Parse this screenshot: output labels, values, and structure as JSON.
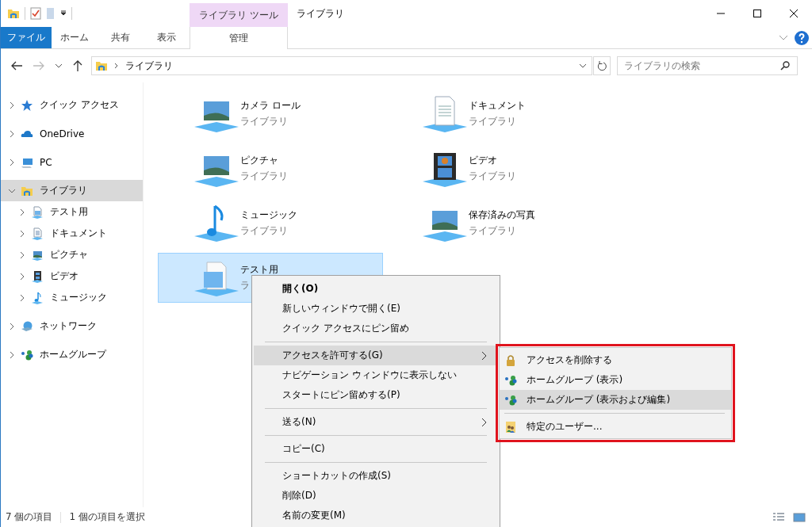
{
  "window": {
    "title": "ライブラリ",
    "contextual_group": "ライブラリ ツール"
  },
  "ribbon_tabs": [
    {
      "label": "ファイル",
      "kind": "file"
    },
    {
      "label": "ホーム",
      "kind": "normal"
    },
    {
      "label": "共有",
      "kind": "normal"
    },
    {
      "label": "表示",
      "kind": "normal"
    },
    {
      "label": "管理",
      "kind": "contextual"
    }
  ],
  "address": {
    "path": "ライブラリ"
  },
  "search": {
    "placeholder": "ライブラリの検索"
  },
  "sidebar": {
    "items": [
      {
        "label": "クイック アクセス",
        "kind": "star",
        "expanded": false,
        "selected": false
      },
      {
        "label": "OneDrive",
        "kind": "cloud",
        "expanded": false,
        "selected": false
      },
      {
        "label": "PC",
        "kind": "pc",
        "expanded": false,
        "selected": false
      },
      {
        "label": "ライブラリ",
        "kind": "library",
        "expanded": true,
        "selected": true,
        "children": [
          {
            "label": "テスト用",
            "kind": "doc",
            "expanded": false,
            "selected": false
          },
          {
            "label": "ドキュメント",
            "kind": "document",
            "expanded": false,
            "selected": false
          },
          {
            "label": "ピクチャ",
            "kind": "picture",
            "expanded": false,
            "selected": false
          },
          {
            "label": "ビデオ",
            "kind": "video",
            "expanded": false,
            "selected": false
          },
          {
            "label": "ミュージック",
            "kind": "music",
            "expanded": false,
            "selected": false
          }
        ]
      },
      {
        "label": "ネットワーク",
        "kind": "network",
        "expanded": false,
        "selected": false
      },
      {
        "label": "ホームグループ",
        "kind": "homegroup",
        "expanded": false,
        "selected": false
      }
    ]
  },
  "libraries": [
    {
      "name": "カメラ ロール",
      "subtitle": "ライブラリ",
      "kind": "picture",
      "selected": false
    },
    {
      "name": "ドキュメント",
      "subtitle": "ライブラリ",
      "kind": "document",
      "selected": false
    },
    {
      "name": "ピクチャ",
      "subtitle": "ライブラリ",
      "kind": "picture",
      "selected": false
    },
    {
      "name": "ビデオ",
      "subtitle": "ライブラリ",
      "kind": "video",
      "selected": false
    },
    {
      "name": "ミュージック",
      "subtitle": "ライブラリ",
      "kind": "music",
      "selected": false
    },
    {
      "name": "保存済みの写真",
      "subtitle": "ライブラリ",
      "kind": "picture",
      "selected": false
    },
    {
      "name": "テスト用",
      "subtitle": "ラ",
      "kind": "doc",
      "selected": true
    }
  ],
  "context_menu": {
    "items": [
      {
        "kind": "item",
        "label": "開く(O)",
        "default": true,
        "submenu": false,
        "selected": false
      },
      {
        "kind": "item",
        "label": "新しいウィンドウで開く(E)",
        "default": false,
        "submenu": false,
        "selected": false
      },
      {
        "kind": "item",
        "label": "クイック アクセスにピン留め",
        "default": false,
        "submenu": false,
        "selected": false
      },
      {
        "kind": "separator"
      },
      {
        "kind": "item",
        "label": "アクセスを許可する(G)",
        "default": false,
        "submenu": true,
        "selected": true
      },
      {
        "kind": "item",
        "label": "ナビゲーション ウィンドウに表示しない",
        "default": false,
        "submenu": false,
        "selected": false
      },
      {
        "kind": "item",
        "label": "スタートにピン留めする(P)",
        "default": false,
        "submenu": false,
        "selected": false
      },
      {
        "kind": "separator"
      },
      {
        "kind": "item",
        "label": "送る(N)",
        "default": false,
        "submenu": true,
        "selected": false
      },
      {
        "kind": "separator"
      },
      {
        "kind": "item",
        "label": "コピー(C)",
        "default": false,
        "submenu": false,
        "selected": false
      },
      {
        "kind": "separator"
      },
      {
        "kind": "item",
        "label": "ショートカットの作成(S)",
        "default": false,
        "submenu": false,
        "selected": false
      },
      {
        "kind": "item",
        "label": "削除(D)",
        "default": false,
        "submenu": false,
        "selected": false
      },
      {
        "kind": "item",
        "label": "名前の変更(M)",
        "default": false,
        "submenu": false,
        "selected": false
      }
    ]
  },
  "submenu": {
    "items": [
      {
        "kind": "lock",
        "label": "アクセスを削除する",
        "selected": false
      },
      {
        "kind": "homegroup",
        "label": "ホームグループ (表示)",
        "selected": false
      },
      {
        "kind": "homegroup",
        "label": "ホームグループ (表示および編集)",
        "selected": true
      },
      {
        "kind": "separator"
      },
      {
        "kind": "users",
        "label": "特定のユーザー...",
        "selected": false
      }
    ]
  },
  "status_bar": {
    "item_count": "7 個の項目",
    "selection": "1 個の項目を選択"
  }
}
